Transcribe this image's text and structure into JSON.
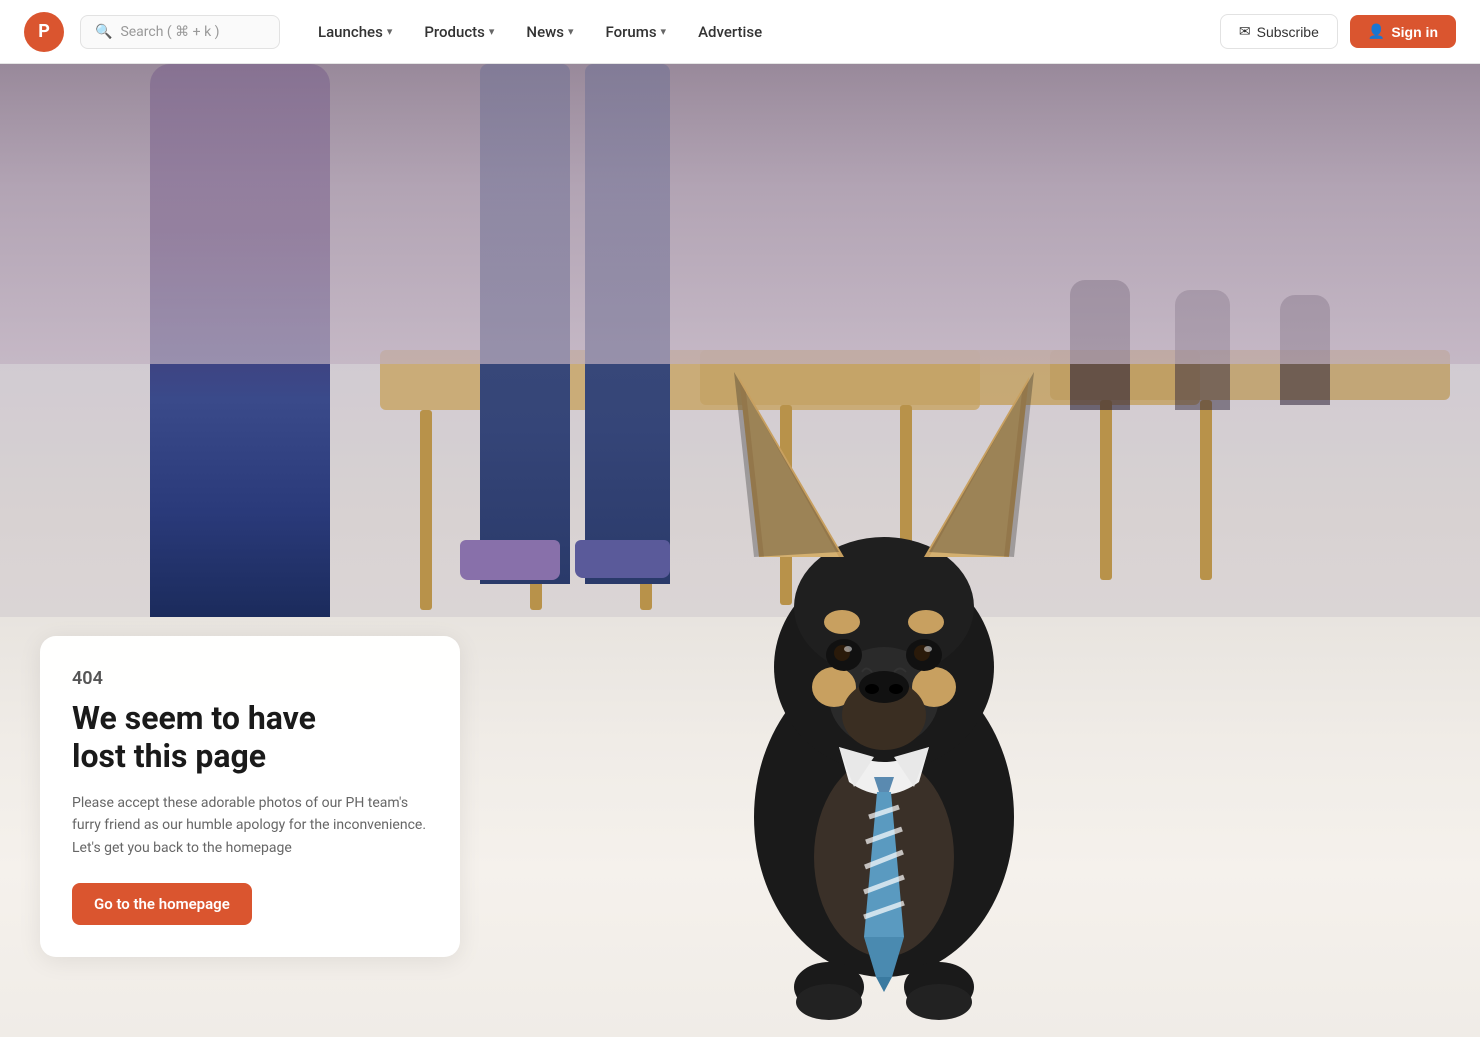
{
  "brand": {
    "logo_letter": "P",
    "logo_color": "#da552f"
  },
  "navbar": {
    "search_placeholder": "Search ( ⌘ + k )",
    "nav_items": [
      {
        "label": "Launches",
        "has_dropdown": true
      },
      {
        "label": "Products",
        "has_dropdown": true
      },
      {
        "label": "News",
        "has_dropdown": true
      },
      {
        "label": "Forums",
        "has_dropdown": true
      },
      {
        "label": "Advertise",
        "has_dropdown": false
      }
    ],
    "subscribe_label": "Subscribe",
    "signin_label": "Sign in"
  },
  "error_page": {
    "code": "404",
    "title_line1": "We seem to have",
    "title_line2": "lost this page",
    "description": "Please accept these adorable photos of our PH team's furry friend as our humble apology for the inconvenience. Let's get you back to the homepage",
    "cta_label": "Go to the homepage"
  }
}
